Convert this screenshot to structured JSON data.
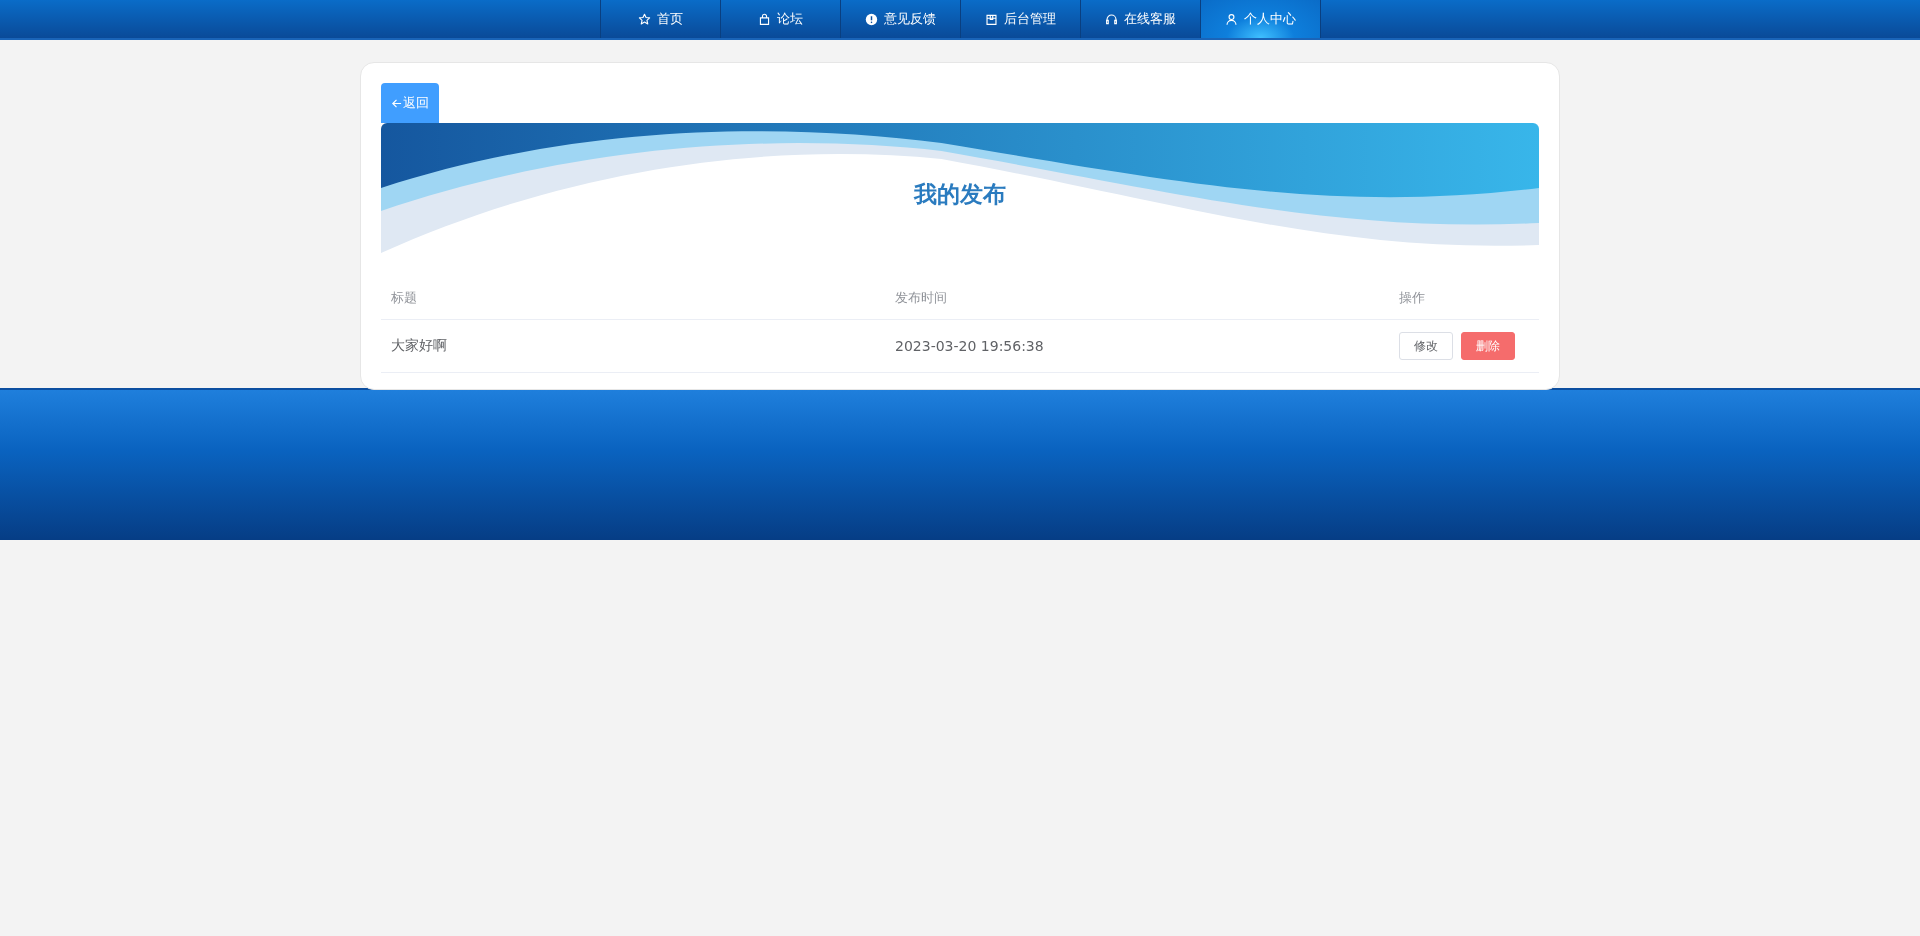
{
  "nav": {
    "items": [
      {
        "label": "首页",
        "kind": "star",
        "selected": false
      },
      {
        "label": "论坛",
        "kind": "bag",
        "selected": false
      },
      {
        "label": "意见反馈",
        "kind": "alert",
        "selected": false
      },
      {
        "label": "后台管理",
        "kind": "box",
        "selected": false
      },
      {
        "label": "在线客服",
        "kind": "headset",
        "selected": false
      },
      {
        "label": "个人中心",
        "kind": "user",
        "selected": true
      }
    ]
  },
  "back_button": {
    "label": "返回"
  },
  "banner": {
    "title": "我的发布"
  },
  "table": {
    "columns": [
      "标题",
      "发布时间",
      "操作"
    ],
    "rows": [
      {
        "title": "大家好啊",
        "time": "2023-03-20 19:56:38",
        "actions": [
          {
            "label": "修改",
            "kind": "edit"
          },
          {
            "label": "删除",
            "kind": "delete"
          }
        ]
      }
    ]
  }
}
